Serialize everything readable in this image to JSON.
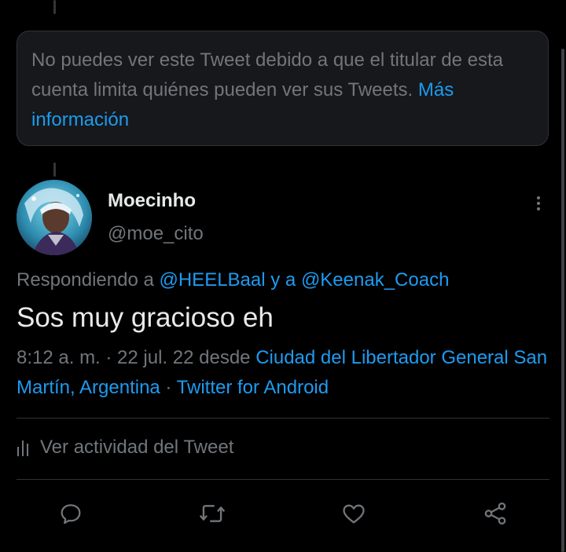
{
  "notice": {
    "text": "No puedes ver este Tweet debido a que el titular de esta cuenta limita quiénes pueden ver sus Tweets. ",
    "link": "Más información"
  },
  "tweet": {
    "display_name": "Moecinho",
    "handle": "@moe_cito",
    "replying_prefix": "Respondiendo a ",
    "replying_user1": "@HEELBaal",
    "replying_conj": " y a ",
    "replying_user2": "@Keenak_Coach",
    "text": "Sos muy gracioso eh",
    "time_date": "8:12 a. m. · 22 jul. 22 desde ",
    "location": "Ciudad del Libertador General San Martín, Argentina",
    "source_sep": " · ",
    "source": "Twitter for Android",
    "activity_label": "Ver actividad del Tweet"
  },
  "icons": [
    "reply-icon",
    "retweet-icon",
    "like-icon",
    "share-icon",
    "analytics-icon",
    "more-icon"
  ],
  "colors": {
    "background": "#000000",
    "link": "#1d9bf0",
    "secondary_text": "#71767b",
    "primary_text": "#e7e9ea"
  }
}
